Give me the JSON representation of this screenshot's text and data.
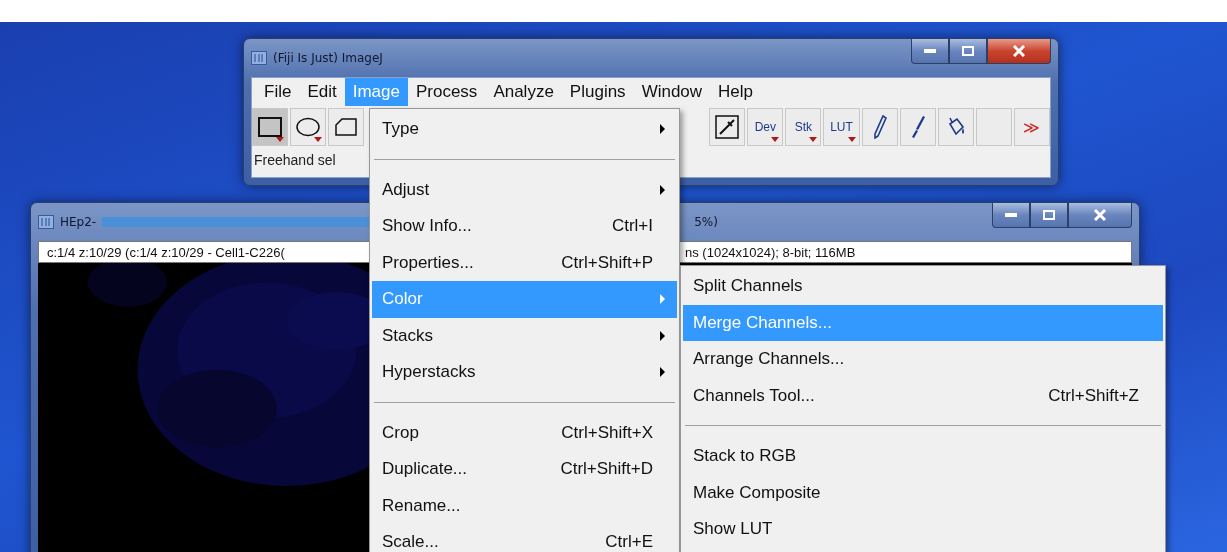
{
  "main_window": {
    "title": "(Fiji Is Just) ImageJ",
    "menu_bar": [
      {
        "label": "File",
        "selected": false
      },
      {
        "label": "Edit",
        "selected": false
      },
      {
        "label": "Image",
        "selected": true
      },
      {
        "label": "Process",
        "selected": false
      },
      {
        "label": "Analyze",
        "selected": false
      },
      {
        "label": "Plugins",
        "selected": false
      },
      {
        "label": "Window",
        "selected": false
      },
      {
        "label": "Help",
        "selected": false
      }
    ],
    "tools_left": [
      {
        "selected": true
      },
      {
        "selected": false
      },
      {
        "selected": false
      }
    ],
    "tools_right": [
      {
        "selected": false
      },
      {
        "label": "Dev",
        "selected": false
      },
      {
        "label": "Stk",
        "selected": false
      },
      {
        "label": "LUT",
        "selected": false
      },
      {
        "selected": false
      },
      {
        "selected": false
      },
      {
        "selected": false
      },
      {
        "selected": false
      },
      {
        "label": "≫",
        "selected": false
      }
    ],
    "status": "Freehand sel"
  },
  "image_window": {
    "title_start": "HEp2-",
    "title_end": "5%)",
    "info_left": "c:1/4 z:10/29 (c:1/4  z:10/29 - Cell1-C226(",
    "info_right": "ns (1024x1024); 8-bit; 116MB"
  },
  "image_menu": [
    {
      "kind": "item",
      "label": "Type",
      "submenu": true,
      "selected": false
    },
    {
      "kind": "separator"
    },
    {
      "kind": "item",
      "label": "Adjust",
      "submenu": true,
      "selected": false
    },
    {
      "kind": "item",
      "label": "Show Info...",
      "shortcut": "Ctrl+I",
      "selected": false
    },
    {
      "kind": "item",
      "label": "Properties...",
      "shortcut": "Ctrl+Shift+P",
      "selected": false
    },
    {
      "kind": "item",
      "label": "Color",
      "submenu": true,
      "selected": true
    },
    {
      "kind": "item",
      "label": "Stacks",
      "submenu": true,
      "selected": false
    },
    {
      "kind": "item",
      "label": "Hyperstacks",
      "submenu": true,
      "selected": false
    },
    {
      "kind": "separator"
    },
    {
      "kind": "item",
      "label": "Crop",
      "shortcut": "Ctrl+Shift+X",
      "selected": false
    },
    {
      "kind": "item",
      "label": "Duplicate...",
      "shortcut": "Ctrl+Shift+D",
      "selected": false
    },
    {
      "kind": "item",
      "label": "Rename...",
      "selected": false
    },
    {
      "kind": "item",
      "label": "Scale...",
      "shortcut": "Ctrl+E",
      "selected": false
    }
  ],
  "color_submenu": [
    {
      "kind": "item",
      "label": "Split Channels",
      "selected": false
    },
    {
      "kind": "item",
      "label": "Merge Channels...",
      "selected": true
    },
    {
      "kind": "item",
      "label": "Arrange Channels...",
      "selected": false
    },
    {
      "kind": "item",
      "label": "Channels Tool...",
      "shortcut": "Ctrl+Shift+Z",
      "selected": false
    },
    {
      "kind": "separator"
    },
    {
      "kind": "item",
      "label": "Stack to RGB",
      "selected": false
    },
    {
      "kind": "item",
      "label": "Make Composite",
      "selected": false
    },
    {
      "kind": "item",
      "label": "Show LUT",
      "selected": false
    }
  ]
}
